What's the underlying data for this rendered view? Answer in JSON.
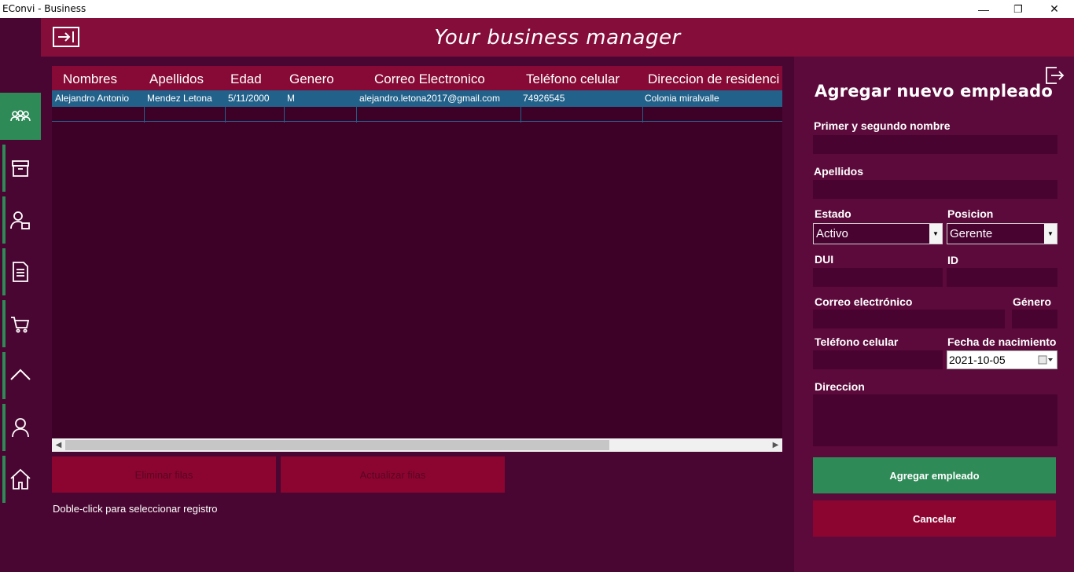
{
  "window": {
    "title": "EConvi - Business",
    "minimize": "—",
    "maximize": "❐",
    "close": "✕"
  },
  "header": {
    "title": "Your business manager"
  },
  "sidebar": {
    "items": [
      {
        "icon": "employees-icon",
        "active": true
      },
      {
        "icon": "archive-box-icon"
      },
      {
        "icon": "user-badge-icon"
      },
      {
        "icon": "document-icon"
      },
      {
        "icon": "cart-icon"
      },
      {
        "icon": "chevron-up-icon"
      },
      {
        "icon": "user-icon"
      },
      {
        "icon": "home-icon"
      }
    ]
  },
  "grid": {
    "columns": [
      "Nombres",
      "Apellidos",
      "Edad",
      "Genero",
      "Correo Electronico",
      "Teléfono celular",
      "Direccion de residenci"
    ],
    "rows": [
      [
        "Alejandro Antonio",
        "Mendez Letona",
        "5/11/2000",
        "M",
        "alejandro.letona2017@gmail.com",
        "74926545",
        "Colonia miralvalle"
      ]
    ]
  },
  "actions": {
    "delete_label": "Eliminar filas",
    "update_label": "Actualizar filas",
    "hint": "Doble-click para seleccionar registro"
  },
  "form": {
    "title": "Agregar nuevo empleado",
    "first_names_label": "Primer y segundo nombre",
    "first_names_value": "",
    "last_names_label": "Apellidos",
    "last_names_value": "",
    "status_label": "Estado",
    "status_value": "Activo",
    "position_label": "Posicion",
    "position_value": "Gerente",
    "dui_label": "DUI",
    "dui_value": "",
    "id_label": "ID",
    "id_value": "",
    "email_label": "Correo electrónico",
    "email_value": "",
    "gender_label": "Género",
    "gender_value": "",
    "phone_label": "Teléfono celular",
    "phone_value": "",
    "birthdate_label": "Fecha de nacimiento",
    "birthdate_value": "2021-10-05",
    "address_label": "Direccion",
    "address_value": "",
    "submit_label": "Agregar empleado",
    "cancel_label": "Cancelar"
  },
  "colors": {
    "accent_green": "#2e8a57",
    "header_crimson": "#850d3a",
    "background_plum": "#4a0632",
    "selection_blue": "#22618a"
  }
}
